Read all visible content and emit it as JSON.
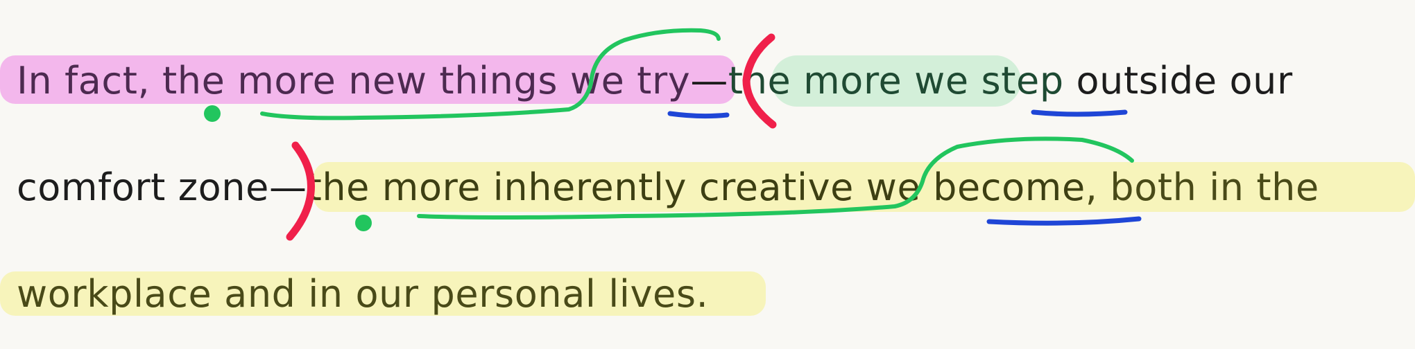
{
  "lines": [
    {
      "spans": [
        {
          "text": "In fact, the more new things"
        },
        {
          "text": " we try"
        },
        {
          "text": "—"
        },
        {
          "text": "the more we step"
        },
        {
          "text": " outside our"
        }
      ]
    },
    {
      "spans": [
        {
          "text": "comfort zone"
        },
        {
          "text": "—"
        },
        {
          "text": "the more inherently creative"
        },
        {
          "text": " we become"
        },
        {
          "text": ", both in the"
        }
      ]
    },
    {
      "spans": [
        {
          "text": "workplace and in our personal lives."
        }
      ]
    }
  ],
  "colors": {
    "highlight_pink": "#f3b7ec",
    "highlight_green": "#d3efd9",
    "highlight_yellow": "#f7f4bb",
    "mark_green": "#22c55e",
    "mark_blue": "#1f46d6",
    "mark_red": "#f0204a"
  }
}
